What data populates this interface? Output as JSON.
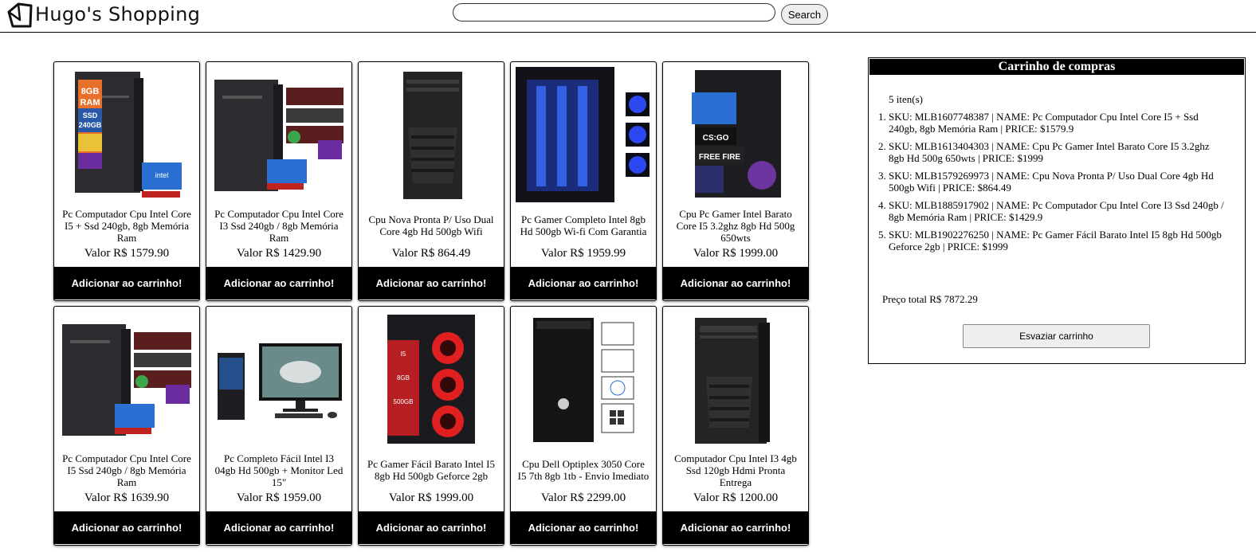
{
  "header": {
    "brand": "Hugo's Shopping",
    "search_placeholder": "",
    "search_button": "Search"
  },
  "products": [
    {
      "name": "Pc Computador Cpu Intel Core I5 + Ssd 240gb, 8gb Memória Ram",
      "price": "Valor R$ 1579.90",
      "button": "Adicionar ao carrinho!"
    },
    {
      "name": "Pc Computador Cpu Intel Core I3 Ssd 240gb / 8gb Memória Ram",
      "price": "Valor R$ 1429.90",
      "button": "Adicionar ao carrinho!"
    },
    {
      "name": "Cpu Nova Pronta P/ Uso Dual Core 4gb Hd 500gb Wifi",
      "price": "Valor R$ 864.49",
      "button": "Adicionar ao carrinho!"
    },
    {
      "name": "Pc Gamer Completo Intel 8gb Hd 500gb Wi-fi Com Garantia",
      "price": "Valor R$ 1959.99",
      "button": "Adicionar ao carrinho!"
    },
    {
      "name": "Cpu Pc Gamer Intel Barato Core I5 3.2ghz 8gb Hd 500g 650wts",
      "price": "Valor R$ 1999.00",
      "button": "Adicionar ao carrinho!"
    },
    {
      "name": "Pc Computador Cpu Intel Core I5 Ssd 240gb / 8gb Memória Ram",
      "price": "Valor R$ 1639.90",
      "button": "Adicionar ao carrinho!"
    },
    {
      "name": "Pc Completo Fácil Intel I3 04gb Hd 500gb + Monitor Led 15\"",
      "price": "Valor R$ 1959.00",
      "button": "Adicionar ao carrinho!"
    },
    {
      "name": "Pc Gamer Fácil Barato Intel I5 8gb Hd 500gb Geforce 2gb",
      "price": "Valor R$ 1999.00",
      "button": "Adicionar ao carrinho!"
    },
    {
      "name": "Cpu Dell Optiplex 3050 Core I5 7th 8gb 1tb - Envio Imediato",
      "price": "Valor R$ 2299.00",
      "button": "Adicionar ao carrinho!"
    },
    {
      "name": "Computador Cpu Intel I3 4gb Ssd 120gb Hdmi Pronta Entrega",
      "price": "Valor R$ 1200.00",
      "button": "Adicionar ao carrinho!"
    }
  ],
  "cart": {
    "title": "Carrinho de compras",
    "count": "5 iten(s)",
    "items": [
      {
        "num": "1.",
        "text": "SKU: MLB1607748387 | NAME: Pc Computador Cpu Intel Core I5 + Ssd 240gb, 8gb Memória Ram | PRICE: $1579.9"
      },
      {
        "num": "2.",
        "text": "SKU: MLB1613404303 | NAME: Cpu Pc Gamer Intel Barato Core I5 3.2ghz 8gb Hd 500g 650wts | PRICE: $1999"
      },
      {
        "num": "3.",
        "text": "SKU: MLB1579269973 | NAME: Cpu Nova Pronta P/ Uso Dual Core 4gb Hd 500gb Wifi | PRICE: $864.49"
      },
      {
        "num": "4.",
        "text": "SKU: MLB1885917902 | NAME: Pc Computador Cpu Intel Core I3 Ssd 240gb / 8gb Memória Ram | PRICE: $1429.9"
      },
      {
        "num": "5.",
        "text": "SKU: MLB1902276250 | NAME: Pc Gamer Fácil Barato Intel I5 8gb Hd 500gb Geforce 2gb | PRICE: $1999"
      }
    ],
    "total": "Preço total R$ 7872.29",
    "empty_button": "Esvaziar carrinho"
  }
}
